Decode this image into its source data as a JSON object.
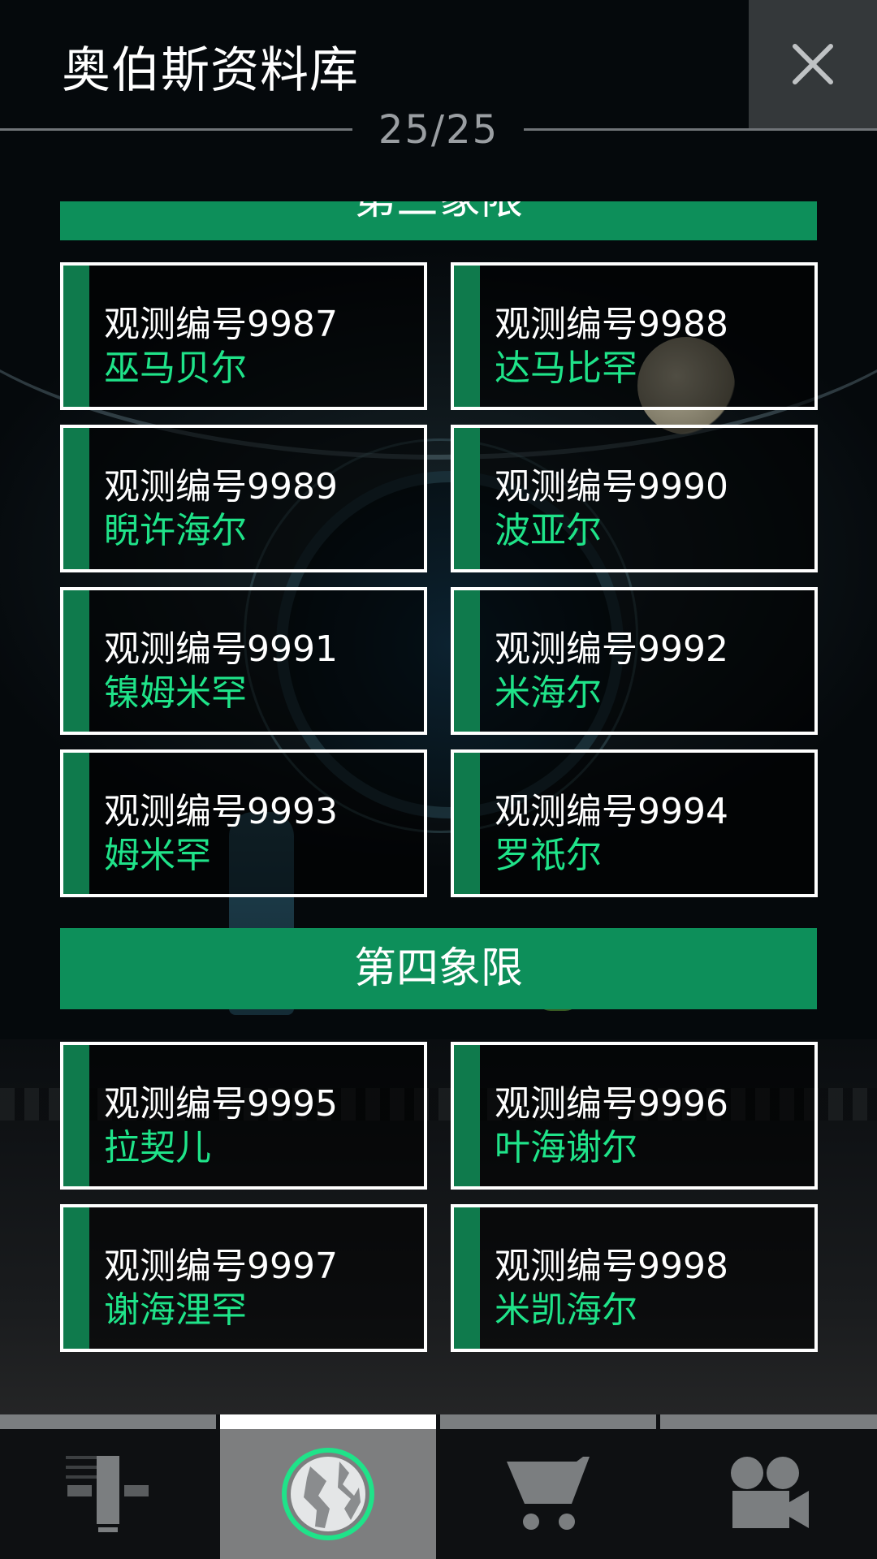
{
  "header": {
    "title": "奥伯斯资料库",
    "page_counter": "25/25",
    "close_icon": "close-icon"
  },
  "sections": [
    {
      "title": "第三象限",
      "entries": [
        {
          "number": "观测编号9987",
          "name": "巫马贝尔"
        },
        {
          "number": "观测编号9988",
          "name": "达马比罕"
        },
        {
          "number": "观测编号9989",
          "name": "睨许海尔"
        },
        {
          "number": "观测编号9990",
          "name": "波亚尔"
        },
        {
          "number": "观测编号9991",
          "name": "镍姆米罕"
        },
        {
          "number": "观测编号9992",
          "name": "米海尔"
        },
        {
          "number": "观测编号9993",
          "name": "姆米罕"
        },
        {
          "number": "观测编号9994",
          "name": "罗祇尔"
        }
      ]
    },
    {
      "title": "第四象限",
      "entries": [
        {
          "number": "观测编号9995",
          "name": "拉契儿"
        },
        {
          "number": "观测编号9996",
          "name": "叶海谢尔"
        },
        {
          "number": "观测编号9997",
          "name": "谢海浬罕"
        },
        {
          "number": "观测编号9998",
          "name": "米凯海尔"
        }
      ]
    }
  ],
  "tabs": [
    {
      "icon": "log-icon",
      "active": false
    },
    {
      "icon": "planet-icon",
      "active": true
    },
    {
      "icon": "cart-icon",
      "active": false
    },
    {
      "icon": "camera-icon",
      "active": false
    }
  ],
  "colors": {
    "accent_green": "#0d8f5a",
    "name_green": "#1fe389",
    "card_bar": "#0f7a4c"
  }
}
